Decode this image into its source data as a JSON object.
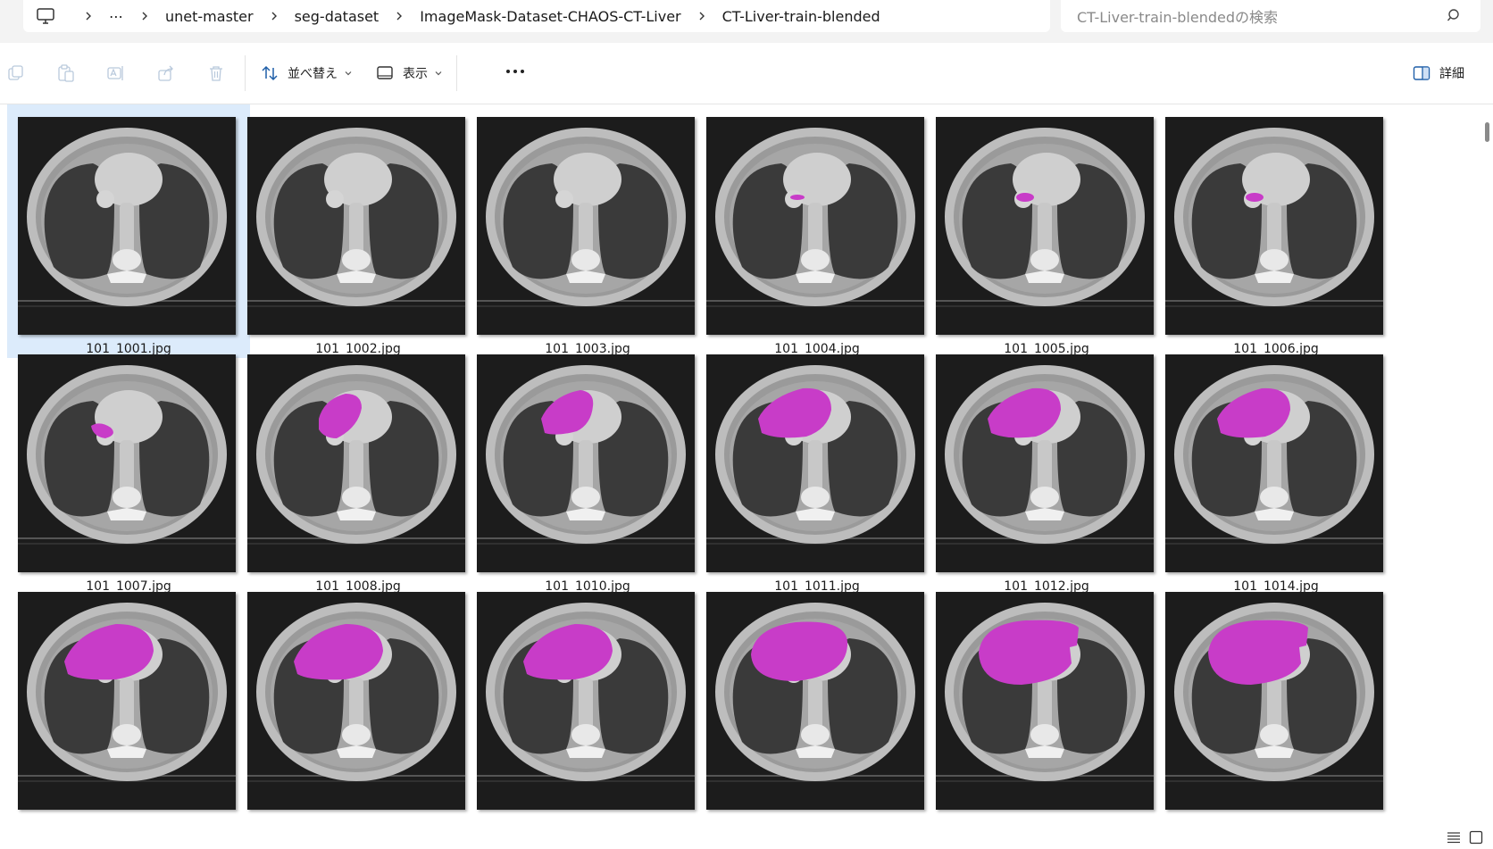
{
  "breadcrumb": {
    "more": "⋯",
    "segments": [
      "unet-master",
      "seg-dataset",
      "ImageMask-Dataset-CHAOS-CT-Liver",
      "CT-Liver-train-blended"
    ]
  },
  "search": {
    "placeholder": "CT-Liver-train-blendedの検索"
  },
  "toolbar": {
    "sort_label": "並べ替え",
    "view_label": "表示",
    "details_label": "詳細"
  },
  "files": [
    {
      "name": "101_1001.jpg",
      "selected": true,
      "mask": 0
    },
    {
      "name": "101_1002.jpg",
      "selected": false,
      "mask": 0
    },
    {
      "name": "101_1003.jpg",
      "selected": false,
      "mask": 0
    },
    {
      "name": "101_1004.jpg",
      "selected": false,
      "mask": 1
    },
    {
      "name": "101_1005.jpg",
      "selected": false,
      "mask": 2
    },
    {
      "name": "101_1006.jpg",
      "selected": false,
      "mask": 2
    },
    {
      "name": "101_1007.jpg",
      "selected": false,
      "mask": 3
    },
    {
      "name": "101_1008.jpg",
      "selected": false,
      "mask": 4
    },
    {
      "name": "101_1010.jpg",
      "selected": false,
      "mask": 5
    },
    {
      "name": "101_1011.jpg",
      "selected": false,
      "mask": 6
    },
    {
      "name": "101_1012.jpg",
      "selected": false,
      "mask": 6
    },
    {
      "name": "101_1014.jpg",
      "selected": false,
      "mask": 6
    },
    {
      "name": "",
      "selected": false,
      "mask": 7
    },
    {
      "name": "",
      "selected": false,
      "mask": 7
    },
    {
      "name": "",
      "selected": false,
      "mask": 7
    },
    {
      "name": "",
      "selected": false,
      "mask": 8
    },
    {
      "name": "",
      "selected": false,
      "mask": 9
    },
    {
      "name": "",
      "selected": false,
      "mask": 9
    }
  ],
  "colors": {
    "mask": "#c83cc8",
    "selection": "#dcebfb",
    "accent": "#0067c0"
  }
}
